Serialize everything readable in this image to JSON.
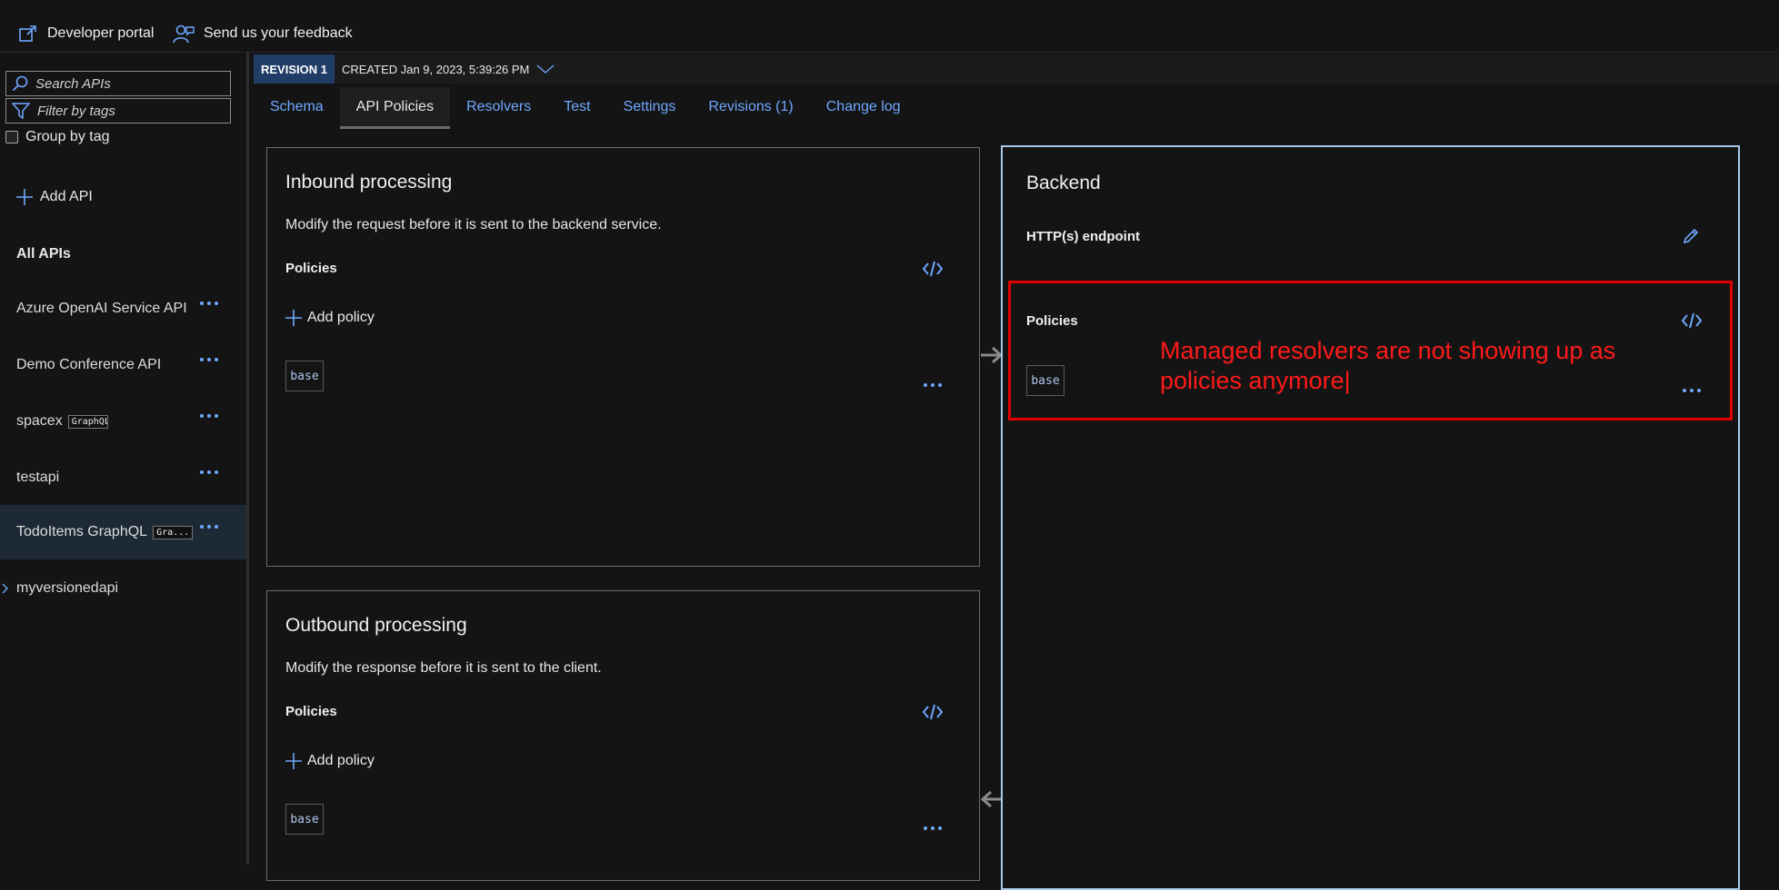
{
  "topbar": {
    "developer_portal": "Developer portal",
    "feedback": "Send us your feedback"
  },
  "sidebar": {
    "search_placeholder": "Search APIs",
    "filter_placeholder": "Filter by tags",
    "group_by_tag": "Group by tag",
    "add_api": "Add API",
    "all_apis": "All APIs",
    "apis": [
      {
        "name": "Azure OpenAI Service API",
        "tag": ""
      },
      {
        "name": "Demo Conference API",
        "tag": ""
      },
      {
        "name": "spacex",
        "tag": "GraphQL"
      },
      {
        "name": "testapi",
        "tag": ""
      },
      {
        "name": "TodoItems GraphQL",
        "tag": "Gra..."
      },
      {
        "name": "myversionedapi",
        "tag": ""
      }
    ]
  },
  "revision": {
    "badge": "REVISION 1",
    "created": "CREATED Jan 9, 2023, 5:39:26 PM"
  },
  "tabs": [
    "Schema",
    "API Policies",
    "Resolvers",
    "Test",
    "Settings",
    "Revisions (1)",
    "Change log"
  ],
  "inbound": {
    "title": "Inbound processing",
    "description": "Modify the request before it is sent to the backend service.",
    "policies_label": "Policies",
    "add_policy": "Add policy",
    "base": "base"
  },
  "outbound": {
    "title": "Outbound processing",
    "description": "Modify the response before it is sent to the client.",
    "policies_label": "Policies",
    "add_policy": "Add policy",
    "base": "base"
  },
  "backend": {
    "title": "Backend",
    "endpoint_label": "HTTP(s) endpoint",
    "policies_label": "Policies",
    "base": "base"
  },
  "annotation": {
    "text": "Managed resolvers are not showing up as policies anymore|"
  },
  "colors": {
    "accent": "#6ea8ff",
    "annotation": "#e00000",
    "revision_badge": "#1f3d66"
  }
}
